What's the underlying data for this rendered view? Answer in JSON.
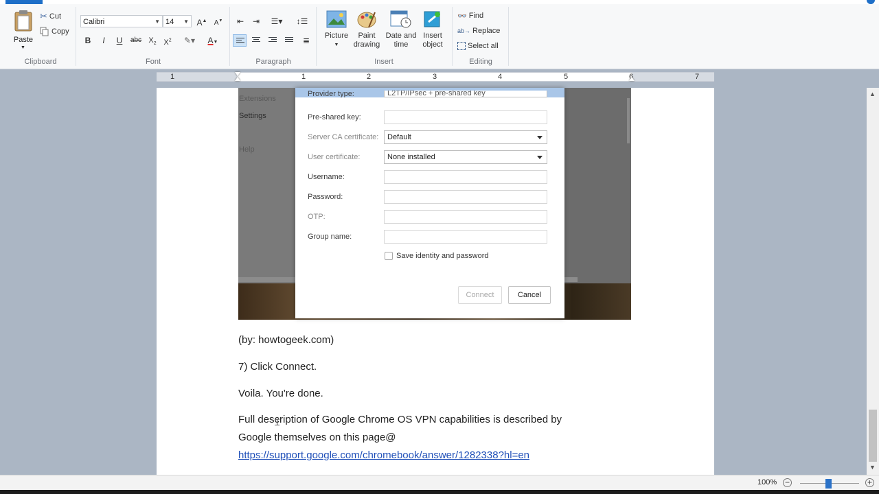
{
  "ribbon": {
    "clipboard": {
      "paste": "Paste",
      "cut": "Cut",
      "copy": "Copy",
      "group": "Clipboard"
    },
    "font": {
      "family": "Calibri",
      "size": "14",
      "group": "Font"
    },
    "paragraph": {
      "group": "Paragraph"
    },
    "insert": {
      "picture": "Picture",
      "paint_drawing": "Paint drawing",
      "date_time": "Date and time",
      "insert_object": "Insert object",
      "group": "Insert"
    },
    "editing": {
      "find": "Find",
      "replace": "Replace",
      "select_all": "Select all",
      "group": "Editing"
    }
  },
  "ruler": {
    "numbers": [
      "1",
      "1",
      "2",
      "3",
      "4",
      "5",
      "6",
      "7"
    ]
  },
  "embedded": {
    "sidebar": [
      "Extensions",
      "Settings",
      "Help"
    ],
    "dialog": {
      "rows": [
        {
          "label": "Provider type:",
          "value": "L2TP/IPsec + pre-shared key"
        },
        {
          "label": "Pre-shared key:",
          "value": ""
        },
        {
          "label": "Server CA certificate:",
          "value": "Default"
        },
        {
          "label": "User certificate:",
          "value": "None installed"
        },
        {
          "label": "Username:",
          "value": ""
        },
        {
          "label": "Password:",
          "value": ""
        },
        {
          "label": "OTP:",
          "value": ""
        },
        {
          "label": "Group name:",
          "value": ""
        }
      ],
      "save_label": "Save identity and password",
      "connect": "Connect",
      "cancel": "Cancel"
    }
  },
  "document": {
    "caption": "(by: howtogeek.com)",
    "step7": "7) Click Connect.",
    "voila": "Voila. You're done.",
    "desc_line1": "Full description of Google Chrome OS VPN capabilities is described by",
    "desc_line2": "Google themselves on this page@",
    "link": "https://support.google.com/chromebook/answer/1282338?hl=en"
  },
  "status": {
    "zoom": "100%"
  },
  "colors": {
    "accent": "#1E6FC8",
    "link": "#1F4FB8",
    "dialog_bar": "#A9C6E8"
  }
}
